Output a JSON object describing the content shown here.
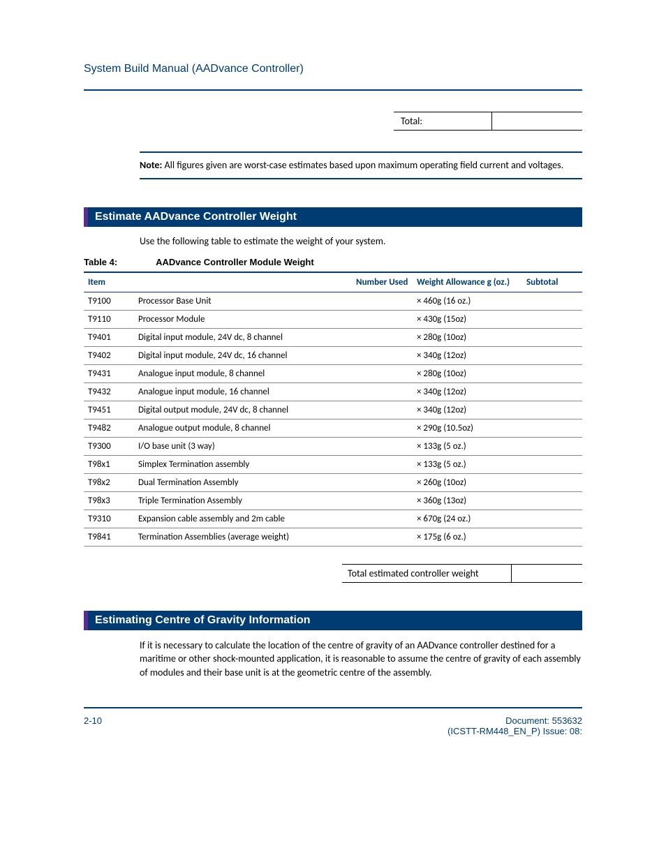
{
  "header": {
    "title": "System Build Manual  (AADvance Controller)"
  },
  "total_row": {
    "label": "Total:",
    "value": ""
  },
  "note": {
    "prefix": "Note:",
    "text": " All figures given are worst-case estimates based upon maximum operating field current and voltages."
  },
  "section1": {
    "heading": "Estimate AADvance Controller Weight",
    "intro": "Use the following table to estimate the weight of your system.",
    "table_number": "Table 4:",
    "table_title": "AADvance Controller Module Weight",
    "columns": {
      "item": "Item",
      "desc_blank": "",
      "number_used": "Number Used",
      "weight_allowance": "Weight Allowance g (oz.)",
      "subtotal": "Subtotal"
    },
    "rows": [
      {
        "item": "T9100",
        "desc": "Processor Base Unit",
        "weight": "× 460g   (16 oz.)"
      },
      {
        "item": "T9110",
        "desc": "Processor Module",
        "weight": "× 430g (15oz)"
      },
      {
        "item": "T9401",
        "desc": "Digital input module, 24V dc, 8 channel",
        "weight": "× 280g (10oz)"
      },
      {
        "item": "T9402",
        "desc": "Digital input module, 24V dc, 16 channel",
        "weight": "× 340g (12oz)"
      },
      {
        "item": "T9431",
        "desc": "Analogue input module, 8 channel",
        "weight": "× 280g (10oz)"
      },
      {
        "item": "T9432",
        "desc": "Analogue input module, 16 channel",
        "weight": "× 340g (12oz)"
      },
      {
        "item": "T9451",
        "desc": "Digital output module, 24V dc, 8 channel",
        "weight": "× 340g (12oz)"
      },
      {
        "item": "T9482",
        "desc": "Analogue output module, 8 channel",
        "weight": "× 290g (10.5oz)"
      },
      {
        "item": "T9300",
        "desc": "I/O base unit (3 way)",
        "weight": "× 133g   (5 oz.)"
      },
      {
        "item": "T98x1",
        "desc": "Simplex Termination assembly",
        "weight": "× 133g   (5 oz.)"
      },
      {
        "item": "T98x2",
        "desc": "Dual Termination Assembly",
        "weight": "× 260g (10oz)"
      },
      {
        "item": "T98x3",
        "desc": "Triple Termination Assembly",
        "weight": "× 360g (13oz)"
      },
      {
        "item": "T9310",
        "desc": "Expansion cable assembly and 2m cable",
        "weight": "× 670g   (24 oz.)"
      },
      {
        "item": "T9841",
        "desc": "Termination Assemblies (average weight)",
        "weight": "× 175g   (6 oz.)"
      }
    ],
    "total_label": "Total estimated controller weight",
    "total_value": ""
  },
  "section2": {
    "heading": "Estimating Centre of Gravity Information",
    "text": "If it is necessary to calculate the location of the centre of gravity of an AADvance controller destined for a maritime or other shock-mounted application, it is reasonable to assume the centre of gravity of each assembly of modules and their base unit is at the geometric centre of the assembly."
  },
  "footer": {
    "page": "2-10",
    "doc_line1": "Document: 553632",
    "doc_line2": "(ICSTT-RM448_EN_P) Issue: 08:"
  }
}
